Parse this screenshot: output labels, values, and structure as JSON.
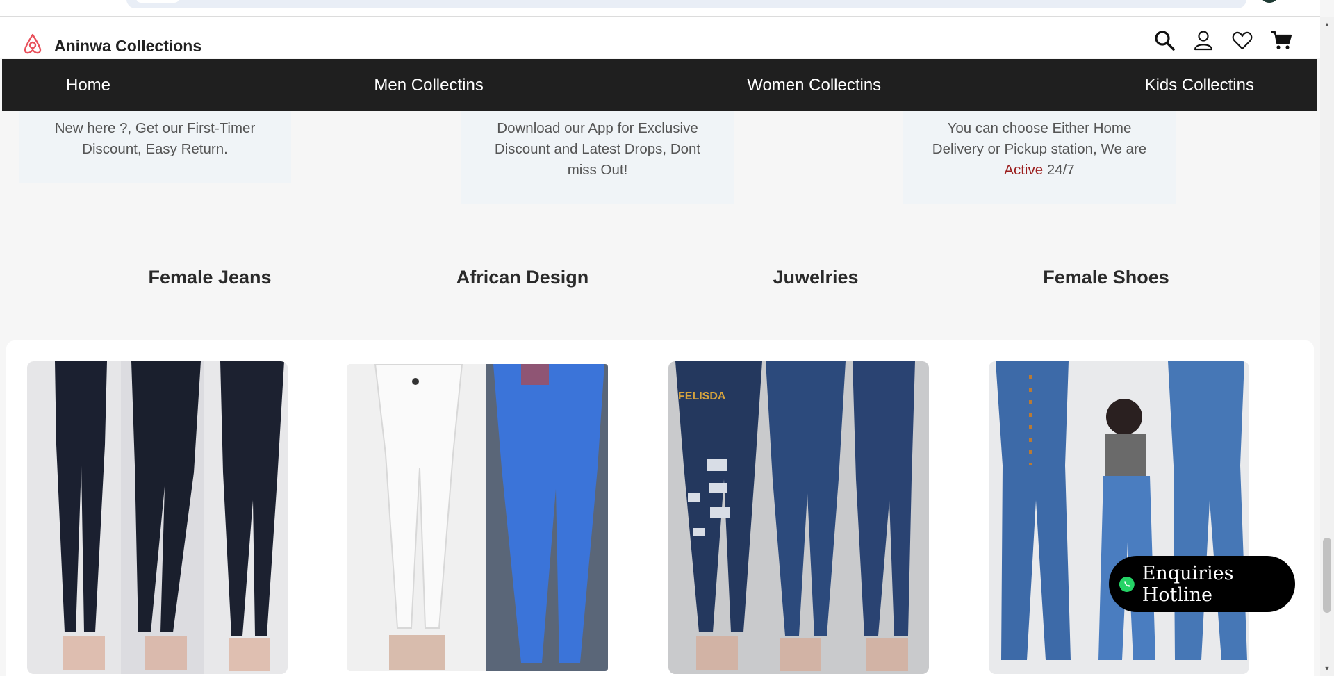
{
  "brand": {
    "name": "Aninwa Collections"
  },
  "nav": {
    "items": [
      {
        "label": "Home"
      },
      {
        "label": "Men Collectins"
      },
      {
        "label": "Women Collectins"
      },
      {
        "label": "Kids Collectins"
      }
    ]
  },
  "info_cards": [
    {
      "text": "New here ?, Get our First-Timer Discount, Easy Return."
    },
    {
      "text": "Download our App for Exclusive Discount and Latest Drops, Dont miss Out!"
    },
    {
      "text_before": "You can choose Either Home Delivery or Pickup station, We are",
      "highlight": "Active",
      "text_after": "24/7"
    }
  ],
  "categories": [
    {
      "label": "Female Jeans"
    },
    {
      "label": "African Design"
    },
    {
      "label": "Juwelries"
    },
    {
      "label": "Female Shoes"
    }
  ],
  "products": [
    {
      "description": "black skinny jeans"
    },
    {
      "description": "white and blue jeans"
    },
    {
      "description": "ripped dark blue jeans",
      "watermark": "FELISDA"
    },
    {
      "description": "flared blue jeans"
    }
  ],
  "hotline": {
    "label": "Enquiries Hotline",
    "icon": "whatsapp-icon"
  },
  "icons": [
    "search-icon",
    "user-icon",
    "heart-icon",
    "cart-icon"
  ],
  "colors": {
    "nav_bg": "#1f1f1f",
    "brand_logo": "#e8505b",
    "active_text": "#9b1d1d",
    "hotline_bg": "#000000",
    "whatsapp": "#25d366"
  }
}
